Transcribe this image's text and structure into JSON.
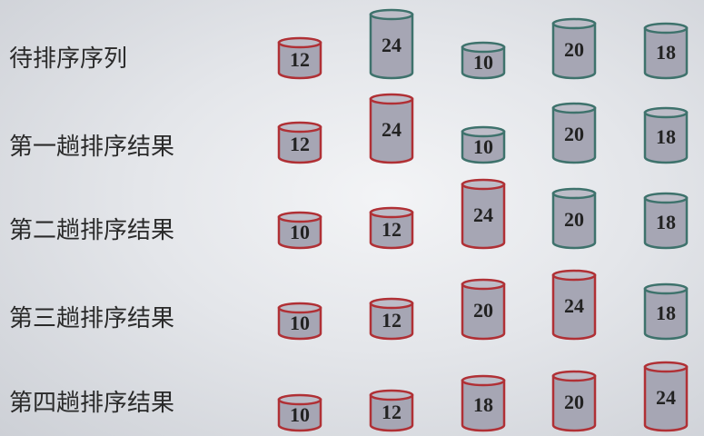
{
  "colors": {
    "sorted": "#b03035",
    "unsorted": "#3e726c",
    "fill": "#a6a6b4",
    "top_fill": "#bdbdc8"
  },
  "rows": [
    {
      "label": "待排序序列",
      "items": [
        {
          "value": "12",
          "state": "sorted"
        },
        {
          "value": "24",
          "state": "unsorted"
        },
        {
          "value": "10",
          "state": "unsorted"
        },
        {
          "value": "20",
          "state": "unsorted"
        },
        {
          "value": "18",
          "state": "unsorted"
        }
      ]
    },
    {
      "label": "第一趟排序结果",
      "items": [
        {
          "value": "12",
          "state": "sorted"
        },
        {
          "value": "24",
          "state": "sorted"
        },
        {
          "value": "10",
          "state": "unsorted"
        },
        {
          "value": "20",
          "state": "unsorted"
        },
        {
          "value": "18",
          "state": "unsorted"
        }
      ]
    },
    {
      "label": "第二趟排序结果",
      "items": [
        {
          "value": "10",
          "state": "sorted"
        },
        {
          "value": "12",
          "state": "sorted"
        },
        {
          "value": "24",
          "state": "sorted"
        },
        {
          "value": "20",
          "state": "unsorted"
        },
        {
          "value": "18",
          "state": "unsorted"
        }
      ]
    },
    {
      "label": "第三趟排序结果",
      "items": [
        {
          "value": "10",
          "state": "sorted"
        },
        {
          "value": "12",
          "state": "sorted"
        },
        {
          "value": "20",
          "state": "sorted"
        },
        {
          "value": "24",
          "state": "sorted"
        },
        {
          "value": "18",
          "state": "unsorted"
        }
      ]
    },
    {
      "label": "第四趟排序结果",
      "items": [
        {
          "value": "10",
          "state": "sorted"
        },
        {
          "value": "12",
          "state": "sorted"
        },
        {
          "value": "18",
          "state": "sorted"
        },
        {
          "value": "20",
          "state": "sorted"
        },
        {
          "value": "24",
          "state": "sorted"
        }
      ]
    }
  ]
}
